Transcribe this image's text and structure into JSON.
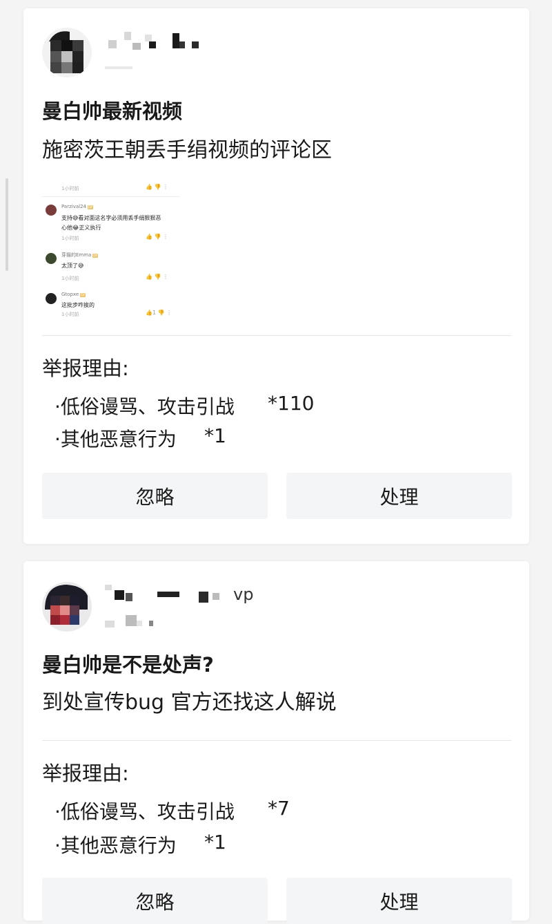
{
  "reports": [
    {
      "title": "曼白帅最新视频",
      "description": "施密茨王朝丢手绢视频的评论区",
      "screenshot_comments": [
        {
          "time": "1小时前",
          "comment_count": "",
          "text": "",
          "likes": ""
        },
        {
          "user": "Parzival24",
          "text": "支持😅看对面这名字必须用丢手绢狠狠恶心他😂正义执行",
          "time": "1小时前",
          "likes": ""
        },
        {
          "user": "芽猫的Emma",
          "text": "太顶了😅",
          "time": "1小时前",
          "likes": ""
        },
        {
          "user": "Gtopxe",
          "text": "这批步咋挨的",
          "time": "1小时前",
          "likes": "1"
        }
      ],
      "reason_heading": "举报理由:",
      "reasons": [
        {
          "label": "·低俗谩骂、攻击引战",
          "count": "*110"
        },
        {
          "label": "·其他恶意行为",
          "count": "*1"
        }
      ],
      "ignore_label": "忽略",
      "handle_label": "处理"
    },
    {
      "user_suffix": "vp",
      "title": "曼白帅是不是处声?",
      "description": "到处宣传bug 官方还找这人解说",
      "reason_heading": "举报理由:",
      "reasons": [
        {
          "label": "·低俗谩骂、攻击引战",
          "count": "*7"
        },
        {
          "label": "·其他恶意行为",
          "count": "*1"
        }
      ],
      "ignore_label": "忽略",
      "handle_label": "处理"
    }
  ],
  "colors": {
    "page_background": "#f4f4f4",
    "card_background": "#ffffff",
    "button_background": "#f4f5f7",
    "text": "#1a1a1a",
    "badge": "#f3c56a"
  }
}
